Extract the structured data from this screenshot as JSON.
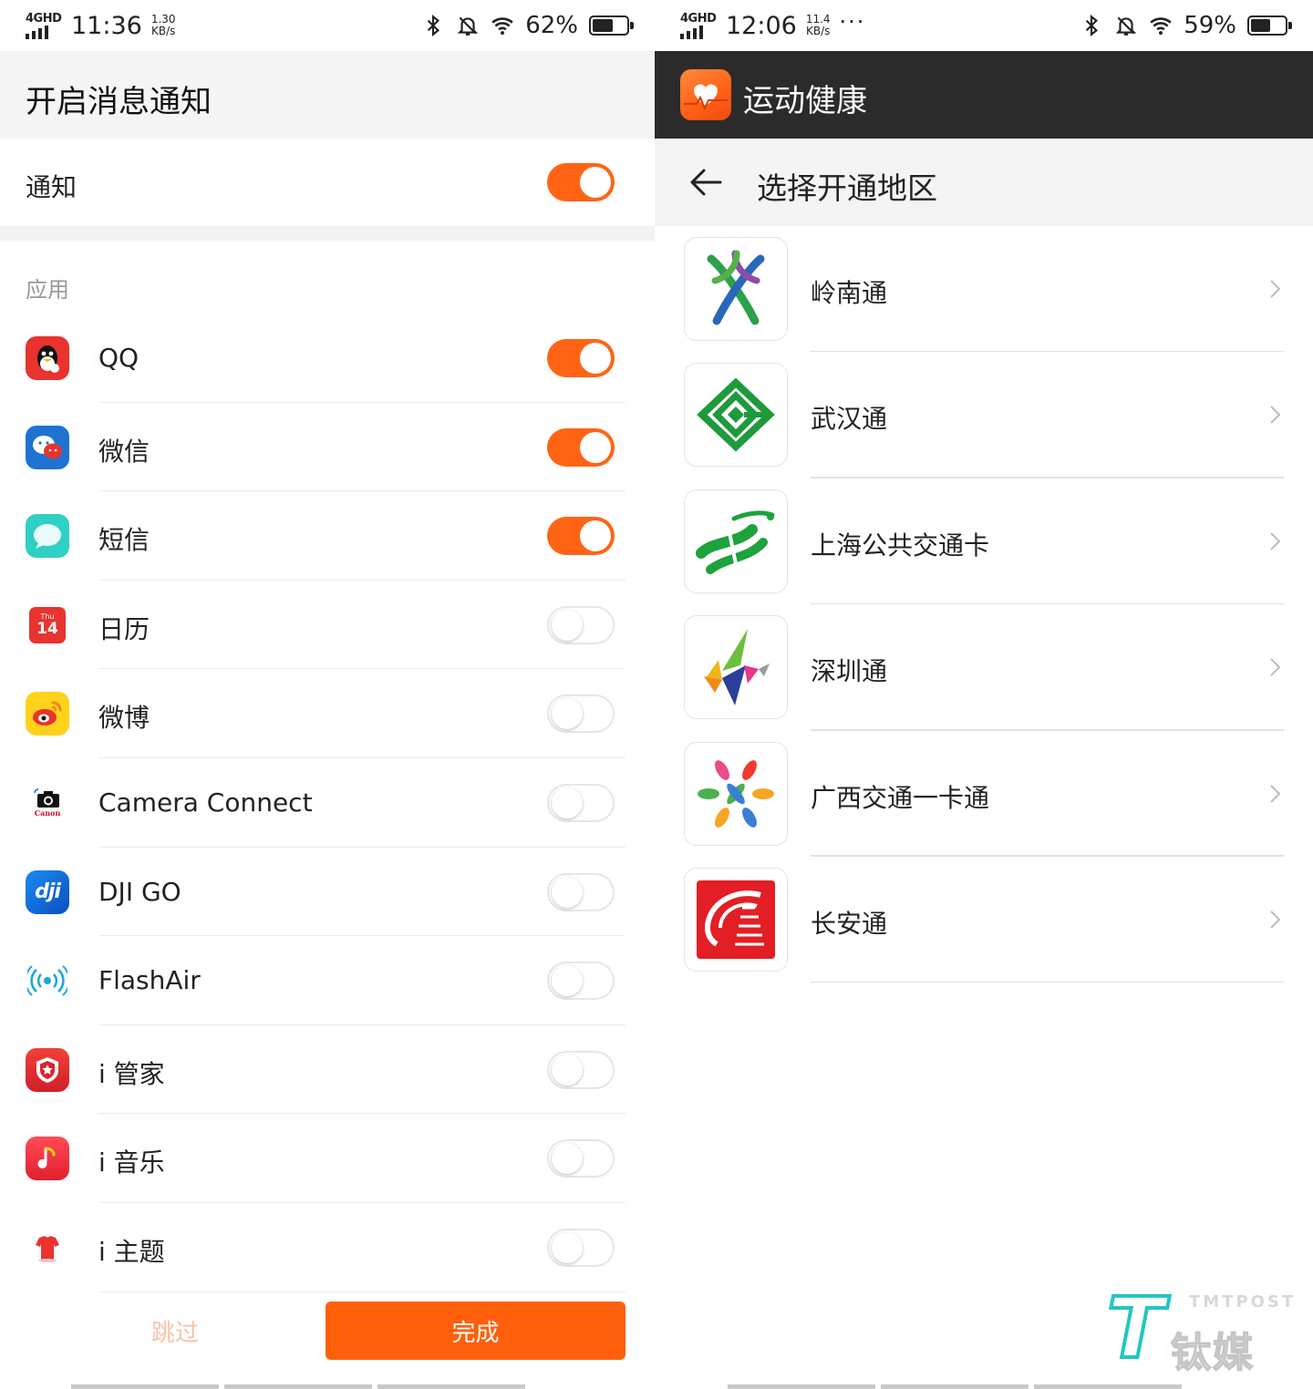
{
  "left_screen": {
    "status_bar": {
      "network": "4GHD",
      "time": "11:36",
      "speed_value": "1.30",
      "speed_unit": "KB/s",
      "battery": "62%",
      "battery_level": 0.62
    },
    "title": "开启消息通知",
    "notification": {
      "label": "通知",
      "enabled": true
    },
    "section_label": "应用",
    "apps": [
      {
        "name": "QQ",
        "icon": "qq-icon",
        "enabled": true
      },
      {
        "name": "微信",
        "icon": "wechat-icon",
        "enabled": true
      },
      {
        "name": "短信",
        "icon": "messages-icon",
        "enabled": true
      },
      {
        "name": "日历",
        "icon": "calendar-icon",
        "enabled": false,
        "icon_text_top": "Thu",
        "icon_text": "14"
      },
      {
        "name": "微博",
        "icon": "weibo-icon",
        "enabled": false
      },
      {
        "name": "Camera Connect",
        "icon": "camera-connect-icon",
        "enabled": false,
        "icon_text": "Canon"
      },
      {
        "name": "DJI GO",
        "icon": "dji-go-icon",
        "enabled": false,
        "icon_text": "dji"
      },
      {
        "name": "FlashAir",
        "icon": "flashair-icon",
        "enabled": false
      },
      {
        "name": "i 管家",
        "icon": "i-manager-icon",
        "enabled": false
      },
      {
        "name": "i 音乐",
        "icon": "i-music-icon",
        "enabled": false
      },
      {
        "name": "i 主题",
        "icon": "i-theme-icon",
        "enabled": false
      }
    ],
    "skip_label": "跳过",
    "done_label": "完成"
  },
  "right_screen": {
    "status_bar": {
      "network": "4GHD",
      "time": "12:06",
      "speed_value": "11.4",
      "speed_unit": "KB/s",
      "dots": "···",
      "battery": "59%",
      "battery_level": 0.59
    },
    "app_title": "运动健康",
    "page_title": "选择开通地区",
    "regions": [
      {
        "name": "岭南通",
        "icon": "lingnantong-logo"
      },
      {
        "name": "武汉通",
        "icon": "wuhantong-logo"
      },
      {
        "name": "上海公共交通卡",
        "icon": "shanghai-transport-card-logo"
      },
      {
        "name": "深圳通",
        "icon": "shenzhentong-logo"
      },
      {
        "name": "广西交通一卡通",
        "icon": "guangxi-transport-card-logo"
      },
      {
        "name": "长安通",
        "icon": "changantong-logo"
      }
    ],
    "watermark": {
      "mark": "T",
      "english": "TMTPOST",
      "chinese": "钛媒体"
    }
  },
  "colors": {
    "accent_orange": "#ff6414",
    "done_button": "#ff5f0a",
    "app_bar_dark": "#2b2b2b",
    "watermark_teal": "#22c6c3"
  }
}
